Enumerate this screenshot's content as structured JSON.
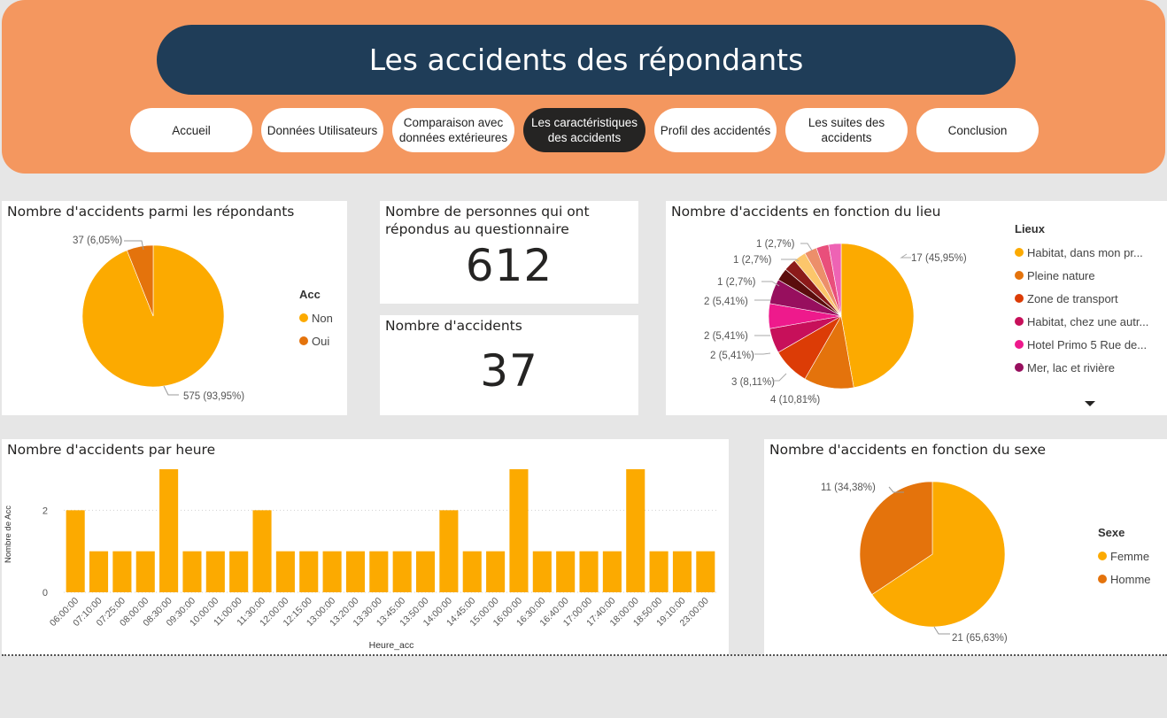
{
  "header": {
    "title": "Les accidents des répondants",
    "nav": [
      {
        "label": "Accueil",
        "active": false
      },
      {
        "label": "Données Utilisateurs",
        "active": false
      },
      {
        "label": "Comparaison avec données extérieures",
        "active": false
      },
      {
        "label": "Les caractéristiques des accidents",
        "active": true
      },
      {
        "label": "Profil des accidentés",
        "active": false
      },
      {
        "label": "Les suites des accidents",
        "active": false
      },
      {
        "label": "Conclusion",
        "active": false
      }
    ]
  },
  "cards": {
    "respondents": {
      "label": "Nombre de personnes qui ont répondus au questionnaire",
      "value": "612"
    },
    "accidents": {
      "label": "Nombre d'accidents",
      "value": "37"
    }
  },
  "colors": {
    "yellow": "#fcaa00",
    "orange": "#e4730c",
    "red": "#dc3c06",
    "crimson": "#c7105a",
    "pink": "#ee1a8c",
    "purple": "#970f5e",
    "dark_red": "#5b0d0d",
    "salmon": "#ec8f6a",
    "light_yellow": "#fcc66b",
    "light_pink": "#e94f7b",
    "hot_pink": "#ee63b4"
  },
  "chart_data": [
    {
      "id": "acc_pie",
      "type": "pie",
      "title": "Nombre d'accidents parmi les répondants",
      "legend_title": "Acc",
      "legend_position": "right",
      "slices": [
        {
          "name": "Non",
          "value": 575,
          "label": "575 (93,95%)",
          "color": "#fcaa00"
        },
        {
          "name": "Oui",
          "value": 37,
          "label": "37 (6,05%)",
          "color": "#e4730c"
        }
      ]
    },
    {
      "id": "lieu_pie",
      "type": "pie",
      "title": "Nombre d'accidents en fonction du lieu",
      "legend_title": "Lieux",
      "legend_position": "right",
      "legend_items": [
        {
          "name": "Habitat, dans mon pr...",
          "color": "#fcaa00"
        },
        {
          "name": "Pleine nature",
          "color": "#e4730c"
        },
        {
          "name": "Zone de transport",
          "color": "#dc3c06"
        },
        {
          "name": "Habitat, chez une autr...",
          "color": "#c7105a"
        },
        {
          "name": "Hotel Primo 5 Rue de...",
          "color": "#ee1a8c"
        },
        {
          "name": "Mer, lac et rivière",
          "color": "#970f5e"
        }
      ],
      "slices": [
        {
          "value": 17,
          "label": "17 (45,95%)",
          "color": "#fcaa00"
        },
        {
          "value": 4,
          "label": "4 (10,81%)",
          "color": "#e4730c"
        },
        {
          "value": 3,
          "label": "3 (8,11%)",
          "color": "#dc3c06"
        },
        {
          "value": 2,
          "label": "2 (5,41%)",
          "color": "#c7105a"
        },
        {
          "value": 2,
          "label": "2 (5,41%)",
          "color": "#ee1a8c"
        },
        {
          "value": 2,
          "label": "2 (5,41%)",
          "color": "#970f5e"
        },
        {
          "value": 1,
          "label": "1 (2,7%)",
          "color": "#5b0d0d"
        },
        {
          "value": 1,
          "label": "",
          "color": "#8c1a1a"
        },
        {
          "value": 1,
          "label": "",
          "color": "#fcc66b"
        },
        {
          "value": 1,
          "label": "1 (2,7%)",
          "color": "#ec8f6a"
        },
        {
          "value": 1,
          "label": "1 (2,7%)",
          "color": "#e94f7b"
        },
        {
          "value": 1,
          "label": "",
          "color": "#ee63b4"
        }
      ]
    },
    {
      "id": "heure_bar",
      "type": "bar",
      "title": "Nombre d'accidents par heure",
      "xlabel": "Heure_acc",
      "ylabel": "Nombre de Acc",
      "ylim": [
        0,
        3
      ],
      "yticks": [
        0,
        2
      ],
      "color": "#fcaa00",
      "categories": [
        "06:00:00",
        "07:10:00",
        "07:25:00",
        "08:00:00",
        "08:30:00",
        "09:30:00",
        "10:00:00",
        "11:00:00",
        "11:30:00",
        "12:00:00",
        "12:15:00",
        "13:00:00",
        "13:20:00",
        "13:30:00",
        "13:45:00",
        "13:50:00",
        "14:00:00",
        "14:45:00",
        "15:00:00",
        "16:00:00",
        "16:30:00",
        "16:40:00",
        "17:00:00",
        "17:40:00",
        "18:00:00",
        "18:50:00",
        "19:10:00",
        "23:00:00"
      ],
      "values": [
        2,
        1,
        1,
        1,
        3,
        1,
        1,
        1,
        2,
        1,
        1,
        1,
        1,
        1,
        1,
        1,
        2,
        1,
        1,
        3,
        1,
        1,
        1,
        1,
        3,
        1,
        1,
        1
      ]
    },
    {
      "id": "sexe_pie",
      "type": "pie",
      "title": "Nombre d'accidents en fonction du sexe",
      "legend_title": "Sexe",
      "legend_position": "right",
      "slices": [
        {
          "name": "Femme",
          "value": 21,
          "label": "21 (65,63%)",
          "color": "#fcaa00"
        },
        {
          "name": "Homme",
          "value": 11,
          "label": "11 (34,38%)",
          "color": "#e4730c"
        }
      ]
    }
  ]
}
